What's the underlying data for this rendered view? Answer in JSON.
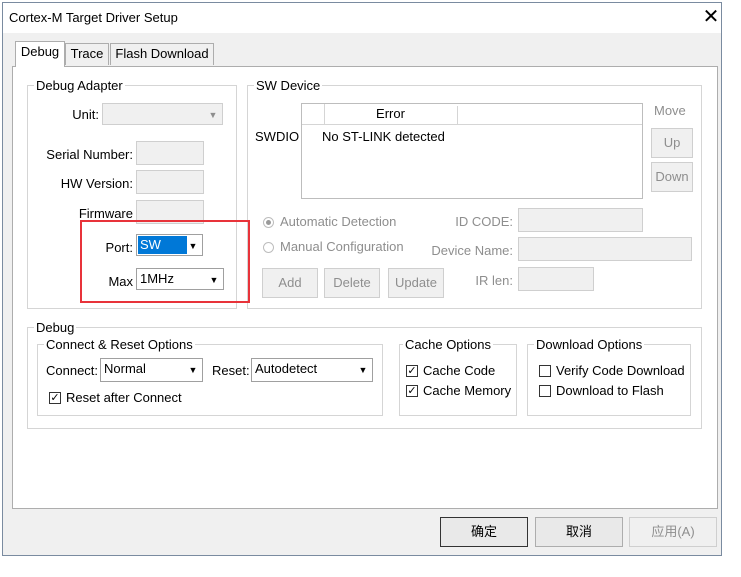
{
  "window": {
    "title": "Cortex-M Target Driver Setup",
    "close_glyph": "✕"
  },
  "tabs": [
    {
      "label": "Debug",
      "active": true
    },
    {
      "label": "Trace",
      "active": false
    },
    {
      "label": "Flash Download",
      "active": false
    }
  ],
  "debug_adapter": {
    "title": "Debug Adapter",
    "unit_label": "Unit:",
    "unit_value": "",
    "serial_label": "Serial Number:",
    "serial_value": "",
    "hw_label": "HW Version:",
    "hw_value": "",
    "firmware_label": "Firmware",
    "firmware_value": "",
    "port_label": "Port:",
    "port_value": "SW",
    "max_label": "Max",
    "max_value": "1MHz"
  },
  "sw_device": {
    "title": "SW Device",
    "table_header_blank": "",
    "table_header_error": "Error",
    "row_label": "SWDIO",
    "row_value": "No ST-LINK detected",
    "move_label": "Move",
    "up_button": "Up",
    "down_button": "Down",
    "auto_detection": "Automatic Detection",
    "manual_config": "Manual Configuration",
    "id_code_label": "ID CODE:",
    "device_name_label": "Device Name:",
    "ir_len_label": "IR len:",
    "add_button": "Add",
    "delete_button": "Delete",
    "update_button": "Update"
  },
  "debug": {
    "title": "Debug",
    "connect_reset": {
      "title": "Connect & Reset Options",
      "connect_label": "Connect:",
      "connect_value": "Normal",
      "reset_label": "Reset:",
      "reset_value": "Autodetect",
      "reset_after_connect": "Reset after Connect",
      "reset_after_connect_checked": true
    },
    "cache": {
      "title": "Cache Options",
      "cache_code": "Cache Code",
      "cache_code_checked": true,
      "cache_memory": "Cache Memory",
      "cache_memory_checked": true
    },
    "download": {
      "title": "Download Options",
      "verify": "Verify Code Download",
      "verify_checked": false,
      "download_flash": "Download to Flash",
      "download_flash_checked": false
    }
  },
  "footer": {
    "ok": "确定",
    "cancel": "取消",
    "apply": "应用(A)"
  },
  "colors": {
    "highlight": "#0078d7",
    "annotation_box": "#e8333a",
    "dialog_bg": "#f0f0f0"
  },
  "checkmark_glyph": "✓",
  "dropdown_arrow_glyph": "▼"
}
